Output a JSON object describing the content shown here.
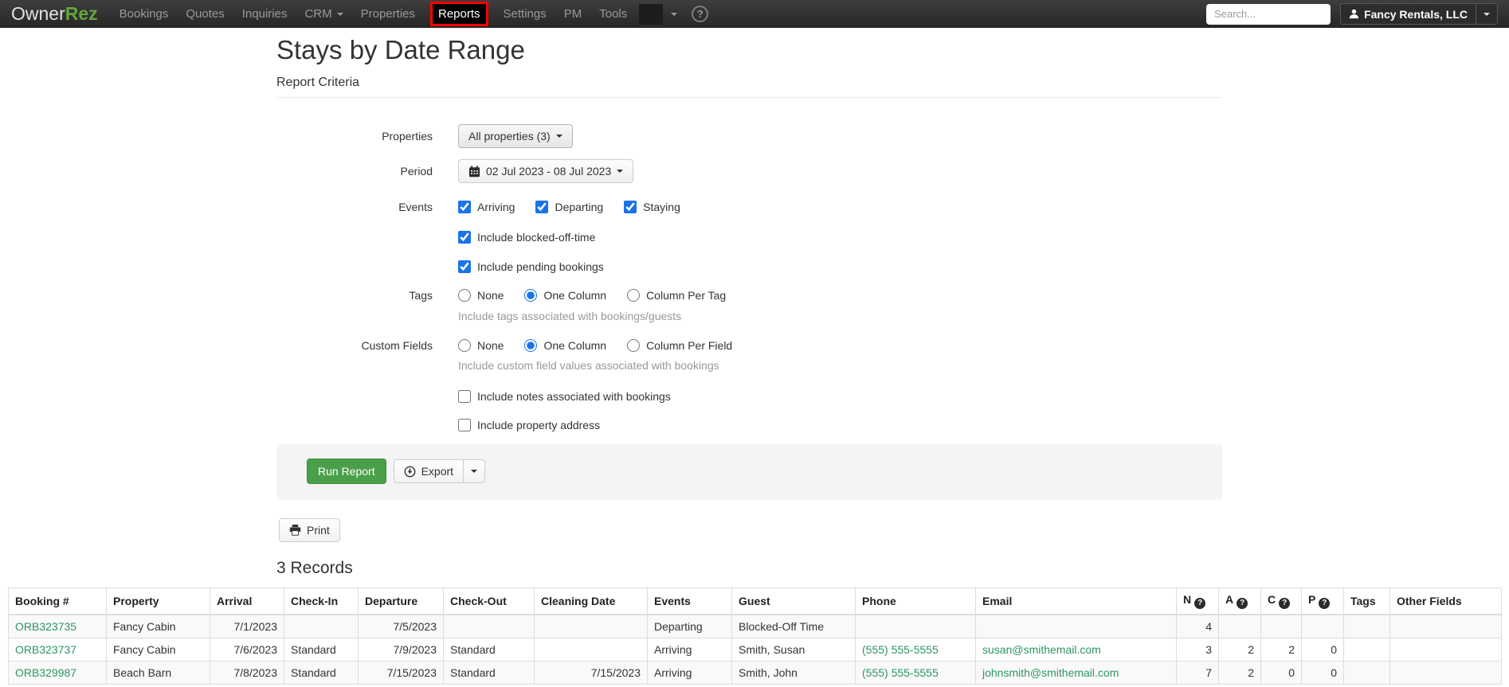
{
  "navbar": {
    "logo": {
      "part1": "Owner",
      "part2": "Rez"
    },
    "items": [
      "Bookings",
      "Quotes",
      "Inquiries",
      "CRM",
      "Properties",
      "Reports",
      "Settings",
      "PM",
      "Tools"
    ],
    "active_item": "Reports",
    "help_icon": "?",
    "search": {
      "placeholder": "Search..."
    },
    "account": {
      "label": "Fancy Rentals, LLC"
    }
  },
  "page": {
    "title": "Stays by Date Range",
    "section_heading": "Report Criteria"
  },
  "criteria": {
    "properties": {
      "label": "Properties",
      "value": "All properties (3)"
    },
    "period": {
      "label": "Period",
      "value": "02 Jul 2023 - 08 Jul 2023"
    },
    "events": {
      "label": "Events",
      "options": [
        {
          "label": "Arriving",
          "checked": true
        },
        {
          "label": "Departing",
          "checked": true
        },
        {
          "label": "Staying",
          "checked": true
        }
      ]
    },
    "include_blocked": {
      "label": "Include blocked-off-time",
      "checked": true
    },
    "include_pending": {
      "label": "Include pending bookings",
      "checked": true
    },
    "tags": {
      "label": "Tags",
      "options": [
        "None",
        "One Column",
        "Column Per Tag"
      ],
      "selected": "One Column",
      "help": "Include tags associated with bookings/guests"
    },
    "custom_fields": {
      "label": "Custom Fields",
      "options": [
        "None",
        "One Column",
        "Column Per Field"
      ],
      "selected": "One Column",
      "help": "Include custom field values associated with bookings"
    },
    "include_notes": {
      "label": "Include notes associated with bookings",
      "checked": false
    },
    "include_address": {
      "label": "Include property address",
      "checked": false
    }
  },
  "actions": {
    "run": "Run Report",
    "export": "Export",
    "print": "Print"
  },
  "records": {
    "heading": "3 Records"
  },
  "table": {
    "columns": [
      {
        "label": "Booking #",
        "type": "link"
      },
      {
        "label": "Property"
      },
      {
        "label": "Arrival",
        "align": "right"
      },
      {
        "label": "Check-In"
      },
      {
        "label": "Departure",
        "align": "right"
      },
      {
        "label": "Check-Out"
      },
      {
        "label": "Cleaning Date",
        "align": "right"
      },
      {
        "label": "Events"
      },
      {
        "label": "Guest"
      },
      {
        "label": "Phone",
        "type": "link"
      },
      {
        "label": "Email",
        "type": "link"
      },
      {
        "label": "N",
        "help": true,
        "align": "right"
      },
      {
        "label": "A",
        "help": true,
        "align": "right"
      },
      {
        "label": "C",
        "help": true,
        "align": "right"
      },
      {
        "label": "P",
        "help": true,
        "align": "right"
      },
      {
        "label": "Tags"
      },
      {
        "label": "Other Fields"
      }
    ],
    "rows": [
      [
        "ORB323735",
        "Fancy Cabin",
        "7/1/2023",
        "",
        "7/5/2023",
        "",
        "",
        "Departing",
        "Blocked-Off Time",
        "",
        "",
        "4",
        "",
        "",
        "",
        "",
        ""
      ],
      [
        "ORB323737",
        "Fancy Cabin",
        "7/6/2023",
        "Standard",
        "7/9/2023",
        "Standard",
        "",
        "Arriving",
        "Smith, Susan",
        "(555) 555-5555",
        "susan@smithemail.com",
        "3",
        "2",
        "2",
        "0",
        "",
        ""
      ],
      [
        "ORB329987",
        "Beach Barn",
        "7/8/2023",
        "Standard",
        "7/15/2023",
        "Standard",
        "7/15/2023",
        "Arriving",
        "Smith, John",
        "(555) 555-5555",
        "johnsmith@smithemail.com",
        "7",
        "2",
        "0",
        "0",
        "",
        ""
      ]
    ]
  },
  "colors": {
    "brand_green": "#64a63c",
    "link_green": "#2d9662",
    "button_green": "#4aa04a",
    "active_tab_border": "#ff0000",
    "control_blue": "#1a73e8"
  }
}
